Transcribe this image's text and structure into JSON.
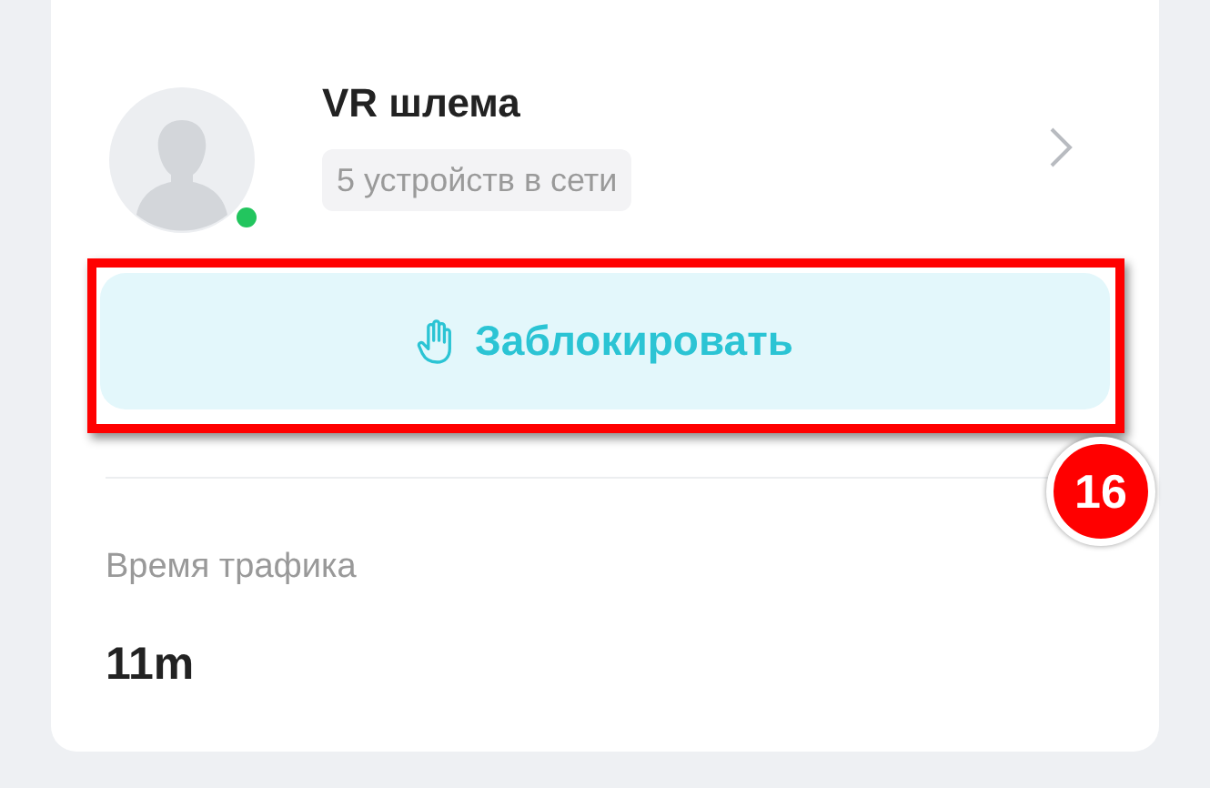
{
  "device": {
    "name": "VR шлема",
    "status": "5 устройств в сети",
    "online": true
  },
  "block_button": {
    "label": "Заблокировать"
  },
  "traffic": {
    "label": "Время трафика",
    "value": "11m"
  },
  "annotation": {
    "number": "16"
  }
}
